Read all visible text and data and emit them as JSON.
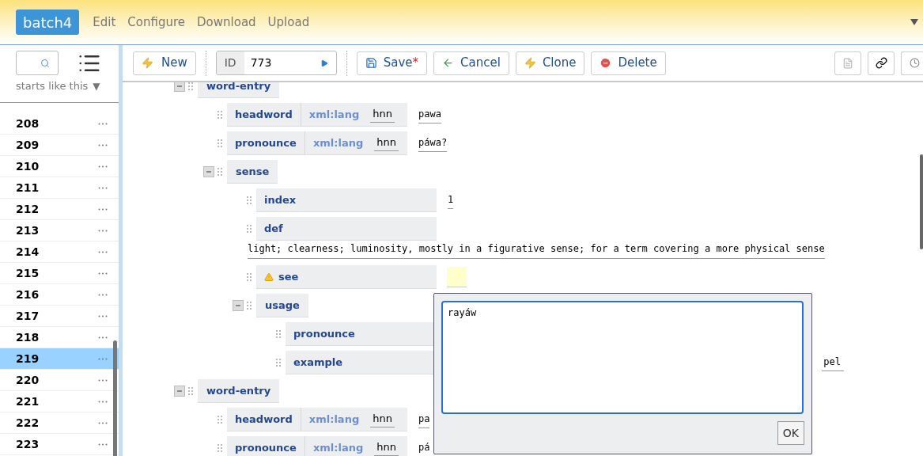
{
  "app": {
    "title": "batch4",
    "menu": [
      "Edit",
      "Configure",
      "Download",
      "Upload"
    ]
  },
  "sidebar": {
    "filter_label": "starts like this",
    "filter_caret": "▼",
    "entries": [
      {
        "label": "208",
        "selected": false
      },
      {
        "label": "209",
        "selected": false
      },
      {
        "label": "210",
        "selected": false
      },
      {
        "label": "211",
        "selected": false
      },
      {
        "label": "212",
        "selected": false
      },
      {
        "label": "213",
        "selected": false
      },
      {
        "label": "214",
        "selected": false
      },
      {
        "label": "215",
        "selected": false
      },
      {
        "label": "216",
        "selected": false
      },
      {
        "label": "217",
        "selected": false
      },
      {
        "label": "218",
        "selected": false
      },
      {
        "label": "219",
        "selected": true
      },
      {
        "label": "220",
        "selected": false
      },
      {
        "label": "221",
        "selected": false
      },
      {
        "label": "222",
        "selected": false
      },
      {
        "label": "223",
        "selected": false
      }
    ]
  },
  "toolbar": {
    "new": "New",
    "id_label": "ID",
    "id_value": "773",
    "buttons": [
      {
        "kind": "save",
        "label": "Save",
        "modified": true,
        "modified_mark": "*"
      },
      {
        "kind": "cancel",
        "label": "Cancel"
      },
      {
        "kind": "clone",
        "label": "Clone"
      },
      {
        "kind": "delete",
        "label": "Delete"
      }
    ]
  },
  "tree": [
    {
      "kind": "element",
      "tag": "word-entry",
      "expanded": true,
      "children": [
        {
          "kind": "field",
          "tag": "headword",
          "attribute": {
            "name": "xml:lang",
            "value": "hnn"
          },
          "value": "pawa"
        },
        {
          "kind": "field",
          "tag": "pronounce",
          "attribute": {
            "name": "xml:lang",
            "value": "hnn"
          },
          "value": "páwa?"
        },
        {
          "kind": "element",
          "tag": "sense",
          "expanded": true,
          "children": [
            {
              "kind": "field",
              "tag": "index",
              "value": "1"
            },
            {
              "kind": "text",
              "tag": "def",
              "value": "light; clearness; luminosity, mostly in a figurative sense; for a term covering a more physical sense"
            },
            {
              "kind": "missing",
              "tag": "see",
              "warning": true
            },
            {
              "kind": "element",
              "tag": "usage",
              "expanded": true,
              "children": [
                {
                  "kind": "field",
                  "tag": "pronounce"
                },
                {
                  "kind": "covered",
                  "tag": "example",
                  "value": "pel"
                }
              ]
            }
          ]
        }
      ]
    },
    {
      "kind": "element",
      "tag": "word-entry",
      "expanded": true,
      "children": [
        {
          "kind": "field",
          "tag": "headword",
          "attribute": {
            "name": "xml:lang",
            "value": "hnn"
          },
          "value": "pa"
        },
        {
          "kind": "field",
          "tag": "pronounce",
          "attribute": {
            "name": "xml:lang",
            "value": "hnn"
          },
          "value": "pá"
        }
      ]
    }
  ],
  "popup": {
    "value": "rayáw",
    "button": "OK"
  }
}
